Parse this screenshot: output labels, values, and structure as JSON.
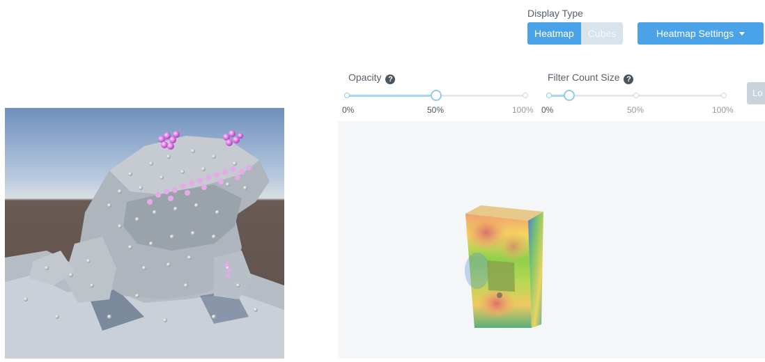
{
  "display_type": {
    "label": "Display Type",
    "options": [
      {
        "label": "Heatmap",
        "active": true
      },
      {
        "label": "Cubes",
        "active": false
      }
    ],
    "settings_button": "Heatmap Settings",
    "accent_color": "#4aa3e8"
  },
  "opacity": {
    "title": "Opacity",
    "value_percent": 50,
    "ticks": [
      "0%",
      "50%",
      "100%"
    ]
  },
  "filter_count_size": {
    "title": "Filter Count Size",
    "value_percent": 13,
    "ticks": [
      "0%",
      "50%",
      "100%"
    ]
  },
  "side_button": {
    "label": "Lo"
  },
  "icons": {
    "help": "question-circle-icon",
    "dropdown": "caret-down-icon"
  },
  "views": {
    "left": "3d-frog-model-with-cube-markers",
    "right": "3d-box-heatmap"
  }
}
